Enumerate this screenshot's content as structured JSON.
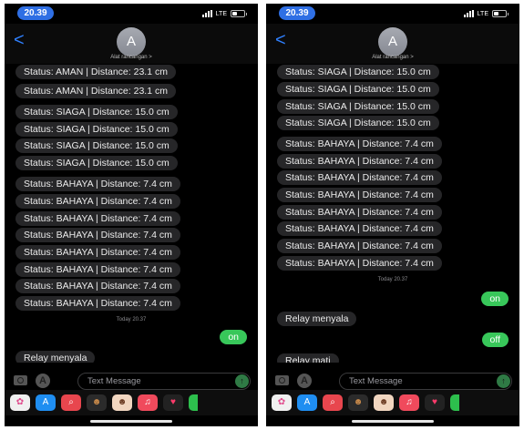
{
  "left": {
    "status_bar": {
      "time": "20.39",
      "network": "LTE"
    },
    "header": {
      "back_label": "<",
      "avatar_letter": "A",
      "contact_name": "Alat rancangan >"
    },
    "messages": {
      "incoming_1": "Status: AMAN | Distance: 23.1 cm",
      "incoming_2": "Status: AMAN | Distance: 23.1 cm",
      "incoming_3": "Status: SIAGA | Distance: 15.0 cm",
      "incoming_4": "Status: SIAGA | Distance: 15.0 cm",
      "incoming_5": "Status: SIAGA | Distance: 15.0 cm",
      "incoming_6": "Status: SIAGA | Distance: 15.0 cm",
      "incoming_7": "Status: BAHAYA | Distance: 7.4 cm",
      "incoming_8": "Status: BAHAYA | Distance: 7.4 cm",
      "incoming_9": "Status: BAHAYA | Distance: 7.4 cm",
      "incoming_10": "Status: BAHAYA | Distance: 7.4 cm",
      "incoming_11": "Status: BAHAYA | Distance: 7.4 cm",
      "incoming_12": "Status: BAHAYA | Distance: 7.4 cm",
      "incoming_13": "Status: BAHAYA | Distance: 7.4 cm",
      "incoming_14": "Status: BAHAYA | Distance: 7.4 cm",
      "timestamp": "Today 20.37",
      "outgoing_1": "on",
      "reply_1": "Relay menyala"
    },
    "input": {
      "placeholder": "Text Message"
    }
  },
  "right": {
    "status_bar": {
      "time": "20.39",
      "network": "LTE"
    },
    "header": {
      "back_label": "<",
      "avatar_letter": "A",
      "contact_name": "Alat rancangan >"
    },
    "messages": {
      "incoming_1": "Status: SIAGA | Distance: 15.0 cm",
      "incoming_2": "Status: SIAGA | Distance: 15.0 cm",
      "incoming_3": "Status: SIAGA | Distance: 15.0 cm",
      "incoming_4": "Status: SIAGA | Distance: 15.0 cm",
      "incoming_5": "Status: BAHAYA | Distance: 7.4 cm",
      "incoming_6": "Status: BAHAYA | Distance: 7.4 cm",
      "incoming_7": "Status: BAHAYA | Distance: 7.4 cm",
      "incoming_8": "Status: BAHAYA | Distance: 7.4 cm",
      "incoming_9": "Status: BAHAYA | Distance: 7.4 cm",
      "incoming_10": "Status: BAHAYA | Distance: 7.4 cm",
      "incoming_11": "Status: BAHAYA | Distance: 7.4 cm",
      "incoming_12": "Status: BAHAYA | Distance: 7.4 cm",
      "timestamp": "Today 20.37",
      "outgoing_1": "on",
      "reply_1": "Relay menyala",
      "outgoing_2": "off",
      "reply_2": "Relay mati"
    },
    "input": {
      "placeholder": "Text Message"
    }
  },
  "app_drawer_icons": [
    "photos-icon",
    "app-store-icon",
    "search-images-icon",
    "memoji-icon",
    "memoji-icon",
    "music-icon",
    "heart-icon",
    "app-icon"
  ],
  "colors": {
    "outgoing_bubble": "#38c75a",
    "incoming_bubble": "#262628",
    "time_pill": "#2f6fe4",
    "back_arrow": "#2f80ff"
  }
}
